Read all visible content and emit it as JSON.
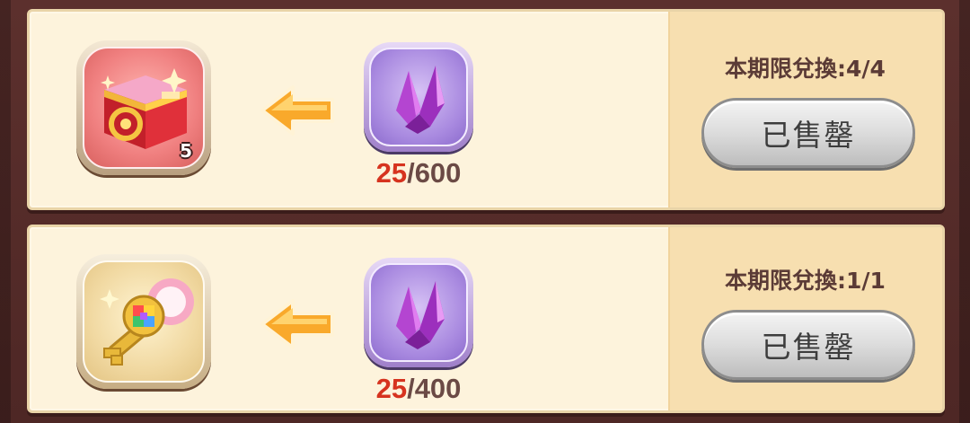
{
  "offers": [
    {
      "reward_icon": "red-treasure-chest-icon",
      "reward_count": "5",
      "arrow_icon": "orange-left-arrow-icon",
      "cost_icon": "purple-crystal-icon",
      "cost_current": "25",
      "cost_separator": "/",
      "cost_required": "600",
      "limit_text": "本期限兌換:4/4",
      "button_label": "已售罄"
    },
    {
      "reward_icon": "rainbow-gem-key-icon",
      "reward_count": "",
      "arrow_icon": "orange-left-arrow-icon",
      "cost_icon": "purple-crystal-icon",
      "cost_current": "25",
      "cost_separator": "/",
      "cost_required": "400",
      "limit_text": "本期限兌換:1/1",
      "button_label": "已售罄"
    }
  ],
  "colors": {
    "card_bg": "#fdf3dc",
    "panel_bg": "#f7dfb0",
    "cost_current_color": "#d6331f",
    "text_brown": "#5b3b36",
    "page_bg": "#5a2f2c"
  }
}
